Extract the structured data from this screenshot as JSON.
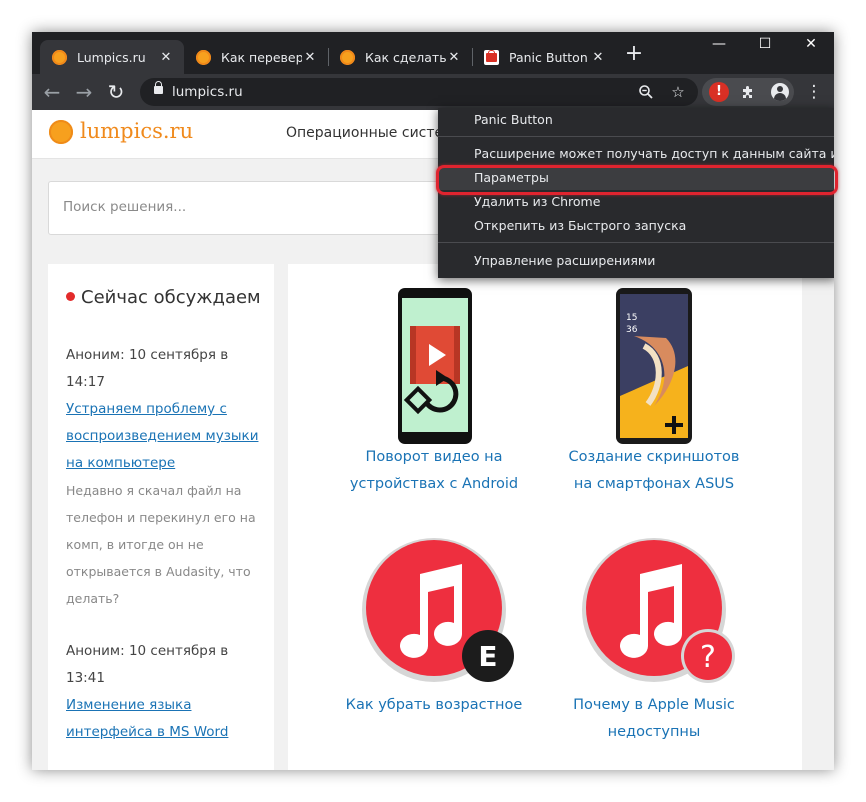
{
  "browser": {
    "tabs": [
      {
        "title": "Lumpics.ru",
        "favicon": "lumpics-favicon",
        "active": true
      },
      {
        "title": "Как переверну",
        "favicon": "lumpics-favicon",
        "active": false
      },
      {
        "title": "Как сделать ск",
        "favicon": "lumpics-favicon",
        "active": false
      },
      {
        "title": "Panic Button -",
        "favicon": "panic-button-favicon",
        "active": false
      }
    ],
    "new_tab": "+",
    "window_controls": {
      "minimize": "—",
      "maximize": "☐",
      "close": "✕"
    },
    "url": "lumpics.ru",
    "extension_badge": "!"
  },
  "site": {
    "logo_text": "lumpics.ru",
    "nav_text": "Операционные систе",
    "search_placeholder": "Поиск решения..."
  },
  "sidebar": {
    "title": "Сейчас обсуждаем",
    "comments": [
      {
        "meta": "Аноним: 10 сентября в 14:17",
        "link": "Устраняем проблему с воспроизведением музыки на компьютере",
        "excerpt": "Недавно я скачал файл на телефон и перекинул его на комп, в итогде он не открывается в Audasity, что делать?"
      },
      {
        "meta": "Аноним: 10 сентября в 13:41",
        "link": "Изменение языка интерфейса в MS Word",
        "excerpt": ""
      }
    ]
  },
  "cards": [
    {
      "caption": "Поворот видео на устройствах с Android"
    },
    {
      "caption": "Создание скриншотов на смартфонах ASUS"
    },
    {
      "caption": "Как убрать возрастное",
      "badge": "E"
    },
    {
      "caption": "Почему в Apple Music недоступны",
      "badge": "?"
    }
  ],
  "context_menu": {
    "header": "Panic Button",
    "items": [
      {
        "label": "Расширение может получать доступ к данным сайта и изменять и",
        "highlighted": false
      },
      {
        "label": "Параметры",
        "highlighted": true
      },
      {
        "label": "Удалить из Chrome",
        "highlighted": false
      },
      {
        "label": "Открепить из Быстрого запуска",
        "highlighted": false
      }
    ],
    "footer": "Управление расширениями"
  },
  "colors": {
    "chrome_dark": "#202124",
    "toolbar": "#35363a",
    "menu_bg": "#292a2d",
    "accent_orange": "#f08a1c",
    "link_blue": "#1a73b5",
    "highlight_red": "#e0242f"
  }
}
